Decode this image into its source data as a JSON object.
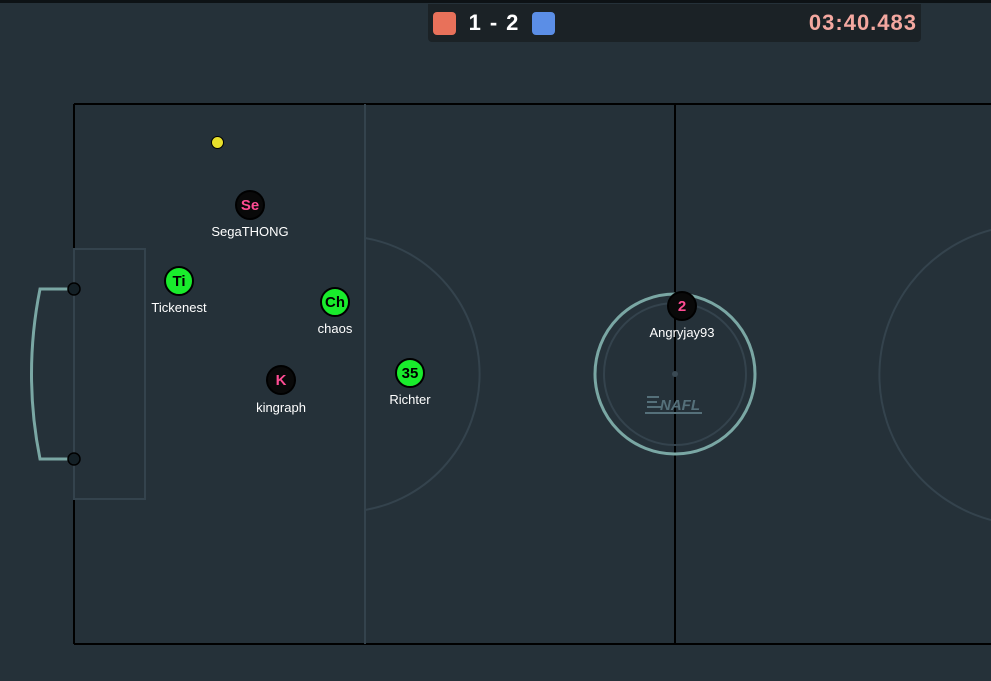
{
  "scoreboard": {
    "red_score": "1",
    "separator": "-",
    "blue_score": "2",
    "timer": "03:40.483"
  },
  "colors": {
    "background": "#253139",
    "red_team": "#e8715a",
    "blue_team": "#5b8ee6",
    "green_player": "#19ec2c",
    "black_player_text": "#ff4c93",
    "timer_text": "#f4a8a0",
    "ball": "#e8e02b"
  },
  "players": [
    {
      "avatar": "Se",
      "name": "SegaTHONG"
    },
    {
      "avatar": "Ti",
      "name": "Tickenest"
    },
    {
      "avatar": "Ch",
      "name": "chaos"
    },
    {
      "avatar": "K",
      "name": "kingraph"
    },
    {
      "avatar": "35",
      "name": "Richter"
    },
    {
      "avatar": "2",
      "name": "Angryjay93"
    }
  ],
  "logo": "NAFL"
}
